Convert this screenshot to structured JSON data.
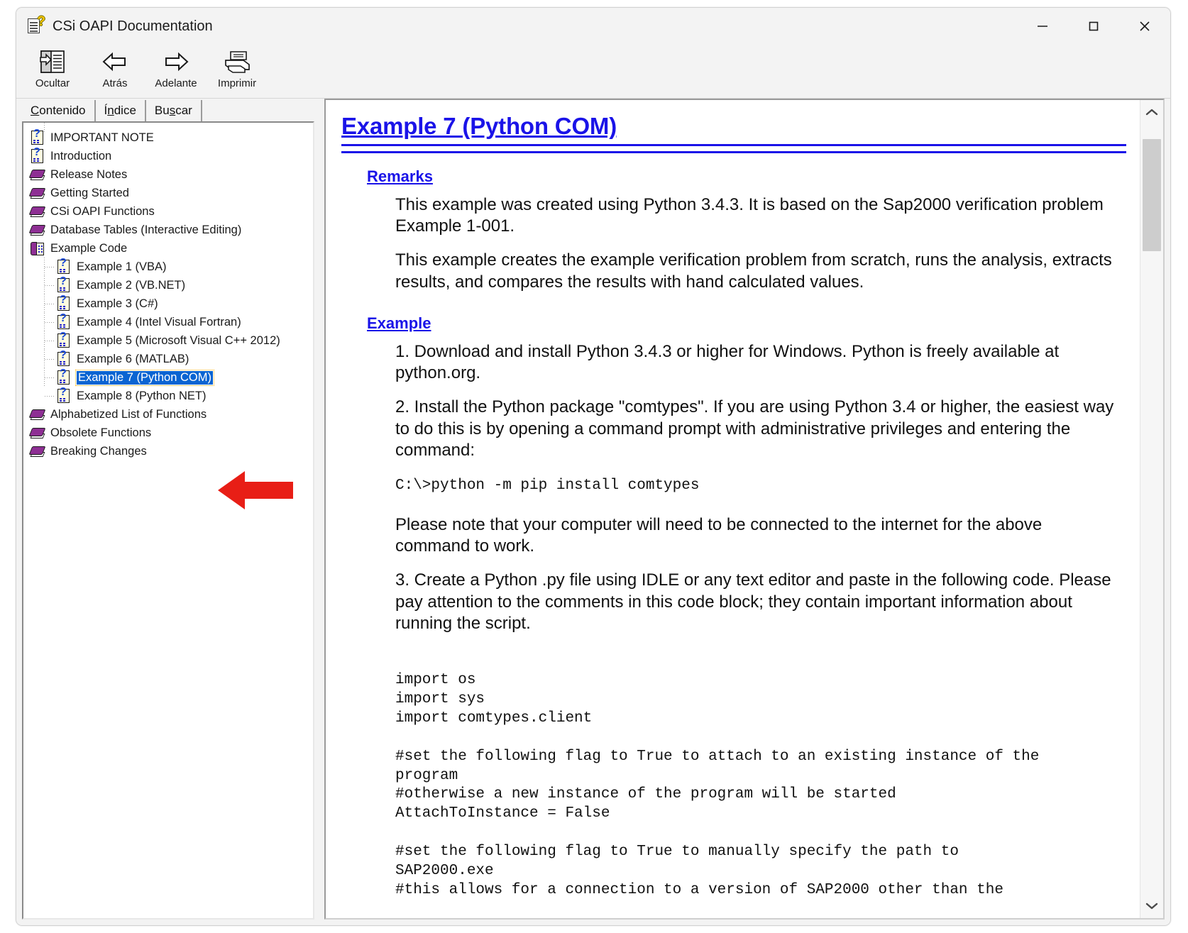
{
  "window": {
    "title": "CSi OAPI Documentation",
    "icon": "help-document-icon",
    "controls": {
      "minimize": "minimize-icon",
      "maximize": "maximize-icon",
      "close": "close-icon"
    }
  },
  "toolbar": {
    "items": [
      {
        "label": "Ocultar",
        "icon": "hide-pane-icon"
      },
      {
        "label": "Atrás",
        "icon": "back-arrow-icon"
      },
      {
        "label": "Adelante",
        "icon": "forward-arrow-icon"
      },
      {
        "label": "Imprimir",
        "icon": "printer-icon"
      }
    ]
  },
  "nav": {
    "tabs": [
      {
        "label": "Contenido",
        "accel": "C",
        "active": true
      },
      {
        "label": "Índice",
        "accel": "n",
        "active": false
      },
      {
        "label": "Buscar",
        "accel": "s",
        "active": false
      }
    ],
    "tree": [
      {
        "label": "IMPORTANT NOTE",
        "icon": "help-page-icon",
        "level": 0,
        "selected": false
      },
      {
        "label": "Introduction",
        "icon": "help-page-icon",
        "level": 0,
        "selected": false
      },
      {
        "label": "Release Notes",
        "icon": "book-icon",
        "level": 0,
        "selected": false
      },
      {
        "label": "Getting Started",
        "icon": "book-icon",
        "level": 0,
        "selected": false
      },
      {
        "label": "CSi OAPI Functions",
        "icon": "book-icon",
        "level": 0,
        "selected": false
      },
      {
        "label": "Database Tables (Interactive Editing)",
        "icon": "book-icon",
        "level": 0,
        "selected": false
      },
      {
        "label": "Example Code",
        "icon": "open-book-icon",
        "level": 0,
        "selected": false
      },
      {
        "label": "Example 1 (VBA)",
        "icon": "help-page-icon",
        "level": 1,
        "selected": false
      },
      {
        "label": "Example 2 (VB.NET)",
        "icon": "help-page-icon",
        "level": 1,
        "selected": false
      },
      {
        "label": "Example 3 (C#)",
        "icon": "help-page-icon",
        "level": 1,
        "selected": false
      },
      {
        "label": "Example 4 (Intel Visual Fortran)",
        "icon": "help-page-icon",
        "level": 1,
        "selected": false
      },
      {
        "label": "Example 5 (Microsoft Visual C++ 2012)",
        "icon": "help-page-icon",
        "level": 1,
        "selected": false
      },
      {
        "label": "Example 6 (MATLAB)",
        "icon": "help-page-icon",
        "level": 1,
        "selected": false
      },
      {
        "label": "Example 7 (Python COM)",
        "icon": "help-page-icon",
        "level": 1,
        "selected": true
      },
      {
        "label": "Example 8 (Python NET)",
        "icon": "help-page-icon",
        "level": 1,
        "selected": false
      },
      {
        "label": "Alphabetized List of Functions",
        "icon": "book-icon",
        "level": 0,
        "selected": false
      },
      {
        "label": "Obsolete Functions",
        "icon": "book-icon",
        "level": 0,
        "selected": false
      },
      {
        "label": "Breaking Changes",
        "icon": "book-icon",
        "level": 0,
        "selected": false
      }
    ]
  },
  "annotation": {
    "arrow": "red-left-arrow",
    "color": "#e81e16",
    "points_to": "Example 7 (Python COM)"
  },
  "document": {
    "title": "Example 7 (Python COM)",
    "sections": [
      {
        "heading": "Remarks"
      },
      {
        "heading": "Example"
      }
    ],
    "remarks": [
      "This example was created using Python 3.4.3. It is based on the Sap2000 verification problem Example 1-001.",
      "This example creates the example verification problem from scratch, runs the analysis, extracts results, and compares the results with hand calculated values."
    ],
    "steps": [
      "1. Download and install Python 3.4.3 or higher for Windows. Python is freely available at python.org.",
      "2. Install the Python package \"comtypes\". If you are using Python 3.4 or higher, the easiest way to do this is by opening a command prompt with administrative privileges and entering the command:",
      "Please note that your computer will need to be connected to the internet for the above command to work.",
      "3. Create a Python .py file using IDLE or any text editor and paste in the following code. Please pay attention to the comments in this code block; they contain important information about running the script."
    ],
    "command": "C:\\>python -m pip install comtypes",
    "code_lines": [
      "import os",
      "import sys",
      "import comtypes.client",
      "",
      "#set the following flag to True to attach to an existing instance of the",
      "program",
      "#otherwise a new instance of the program will be started",
      "AttachToInstance = False",
      "",
      "#set the following flag to True to manually specify the path to",
      "SAP2000.exe",
      "#this allows for a connection to a version of SAP2000 other than the"
    ]
  },
  "scrollbar": {
    "up_icon": "chevron-up-icon",
    "down_icon": "chevron-down-icon",
    "orientation": "vertical"
  },
  "colors": {
    "link": "#1a13e8",
    "selection": "#0a64d2",
    "annotation": "#e81e16",
    "book": "#8e2f94"
  }
}
